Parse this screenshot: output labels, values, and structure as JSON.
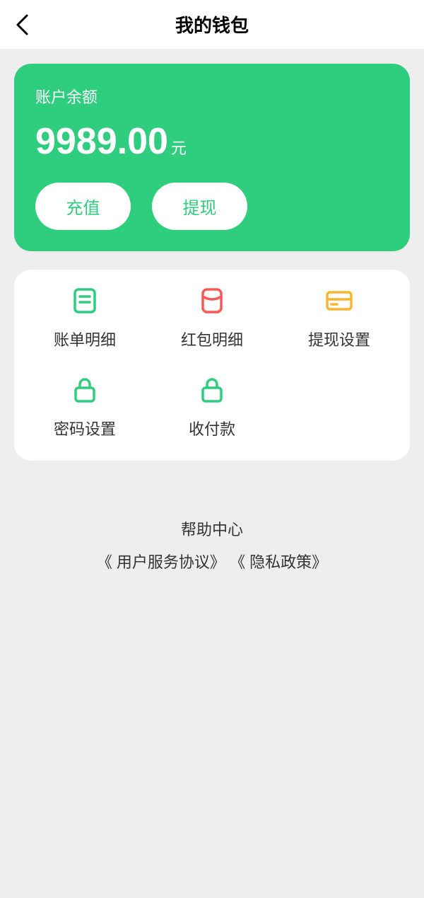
{
  "header": {
    "title": "我的钱包"
  },
  "balance": {
    "label": "账户余额",
    "value": "9989.00",
    "unit": "元",
    "recharge": "充值",
    "withdraw": "提现"
  },
  "menu": {
    "items": [
      {
        "label": "账单明细",
        "icon": "bill-icon"
      },
      {
        "label": "红包明细",
        "icon": "redpacket-icon"
      },
      {
        "label": "提现设置",
        "icon": "card-icon"
      },
      {
        "label": "密码设置",
        "icon": "lock-icon"
      },
      {
        "label": "收付款",
        "icon": "lock-icon"
      }
    ]
  },
  "footer": {
    "help": "帮助中心",
    "tos": "《 用户服务协议》",
    "privacy": "《 隐私政策》"
  }
}
